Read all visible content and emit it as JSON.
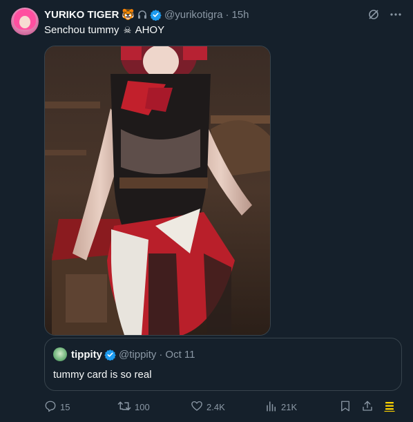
{
  "tweet": {
    "display_name": "YURIKO TIGER",
    "name_emoji": "🐯",
    "handle": "@yurikotigra",
    "separator": "·",
    "time": "15h",
    "text_before": "Senchou tummy",
    "text_emoji": "☠",
    "text_after": "AHOY"
  },
  "quote": {
    "display_name": "tippity",
    "handle": "@tippity",
    "separator": "·",
    "date": "Oct 11",
    "text": "tummy card is so real"
  },
  "actions": {
    "replies": "15",
    "retweets": "100",
    "likes": "2.4K",
    "views": "21K"
  },
  "colors": {
    "background": "#15202b",
    "text": "#f7f9f9",
    "secondary": "#8b98a5",
    "verified": "#1d9bf0",
    "border": "#38444d",
    "grok_accent": "#ffd400"
  },
  "icons": [
    "headphones-icon",
    "verified-icon",
    "grok-icon",
    "more-icon",
    "reply-icon",
    "retweet-icon",
    "like-icon",
    "views-icon",
    "bookmark-icon",
    "share-icon",
    "stack-icon"
  ]
}
